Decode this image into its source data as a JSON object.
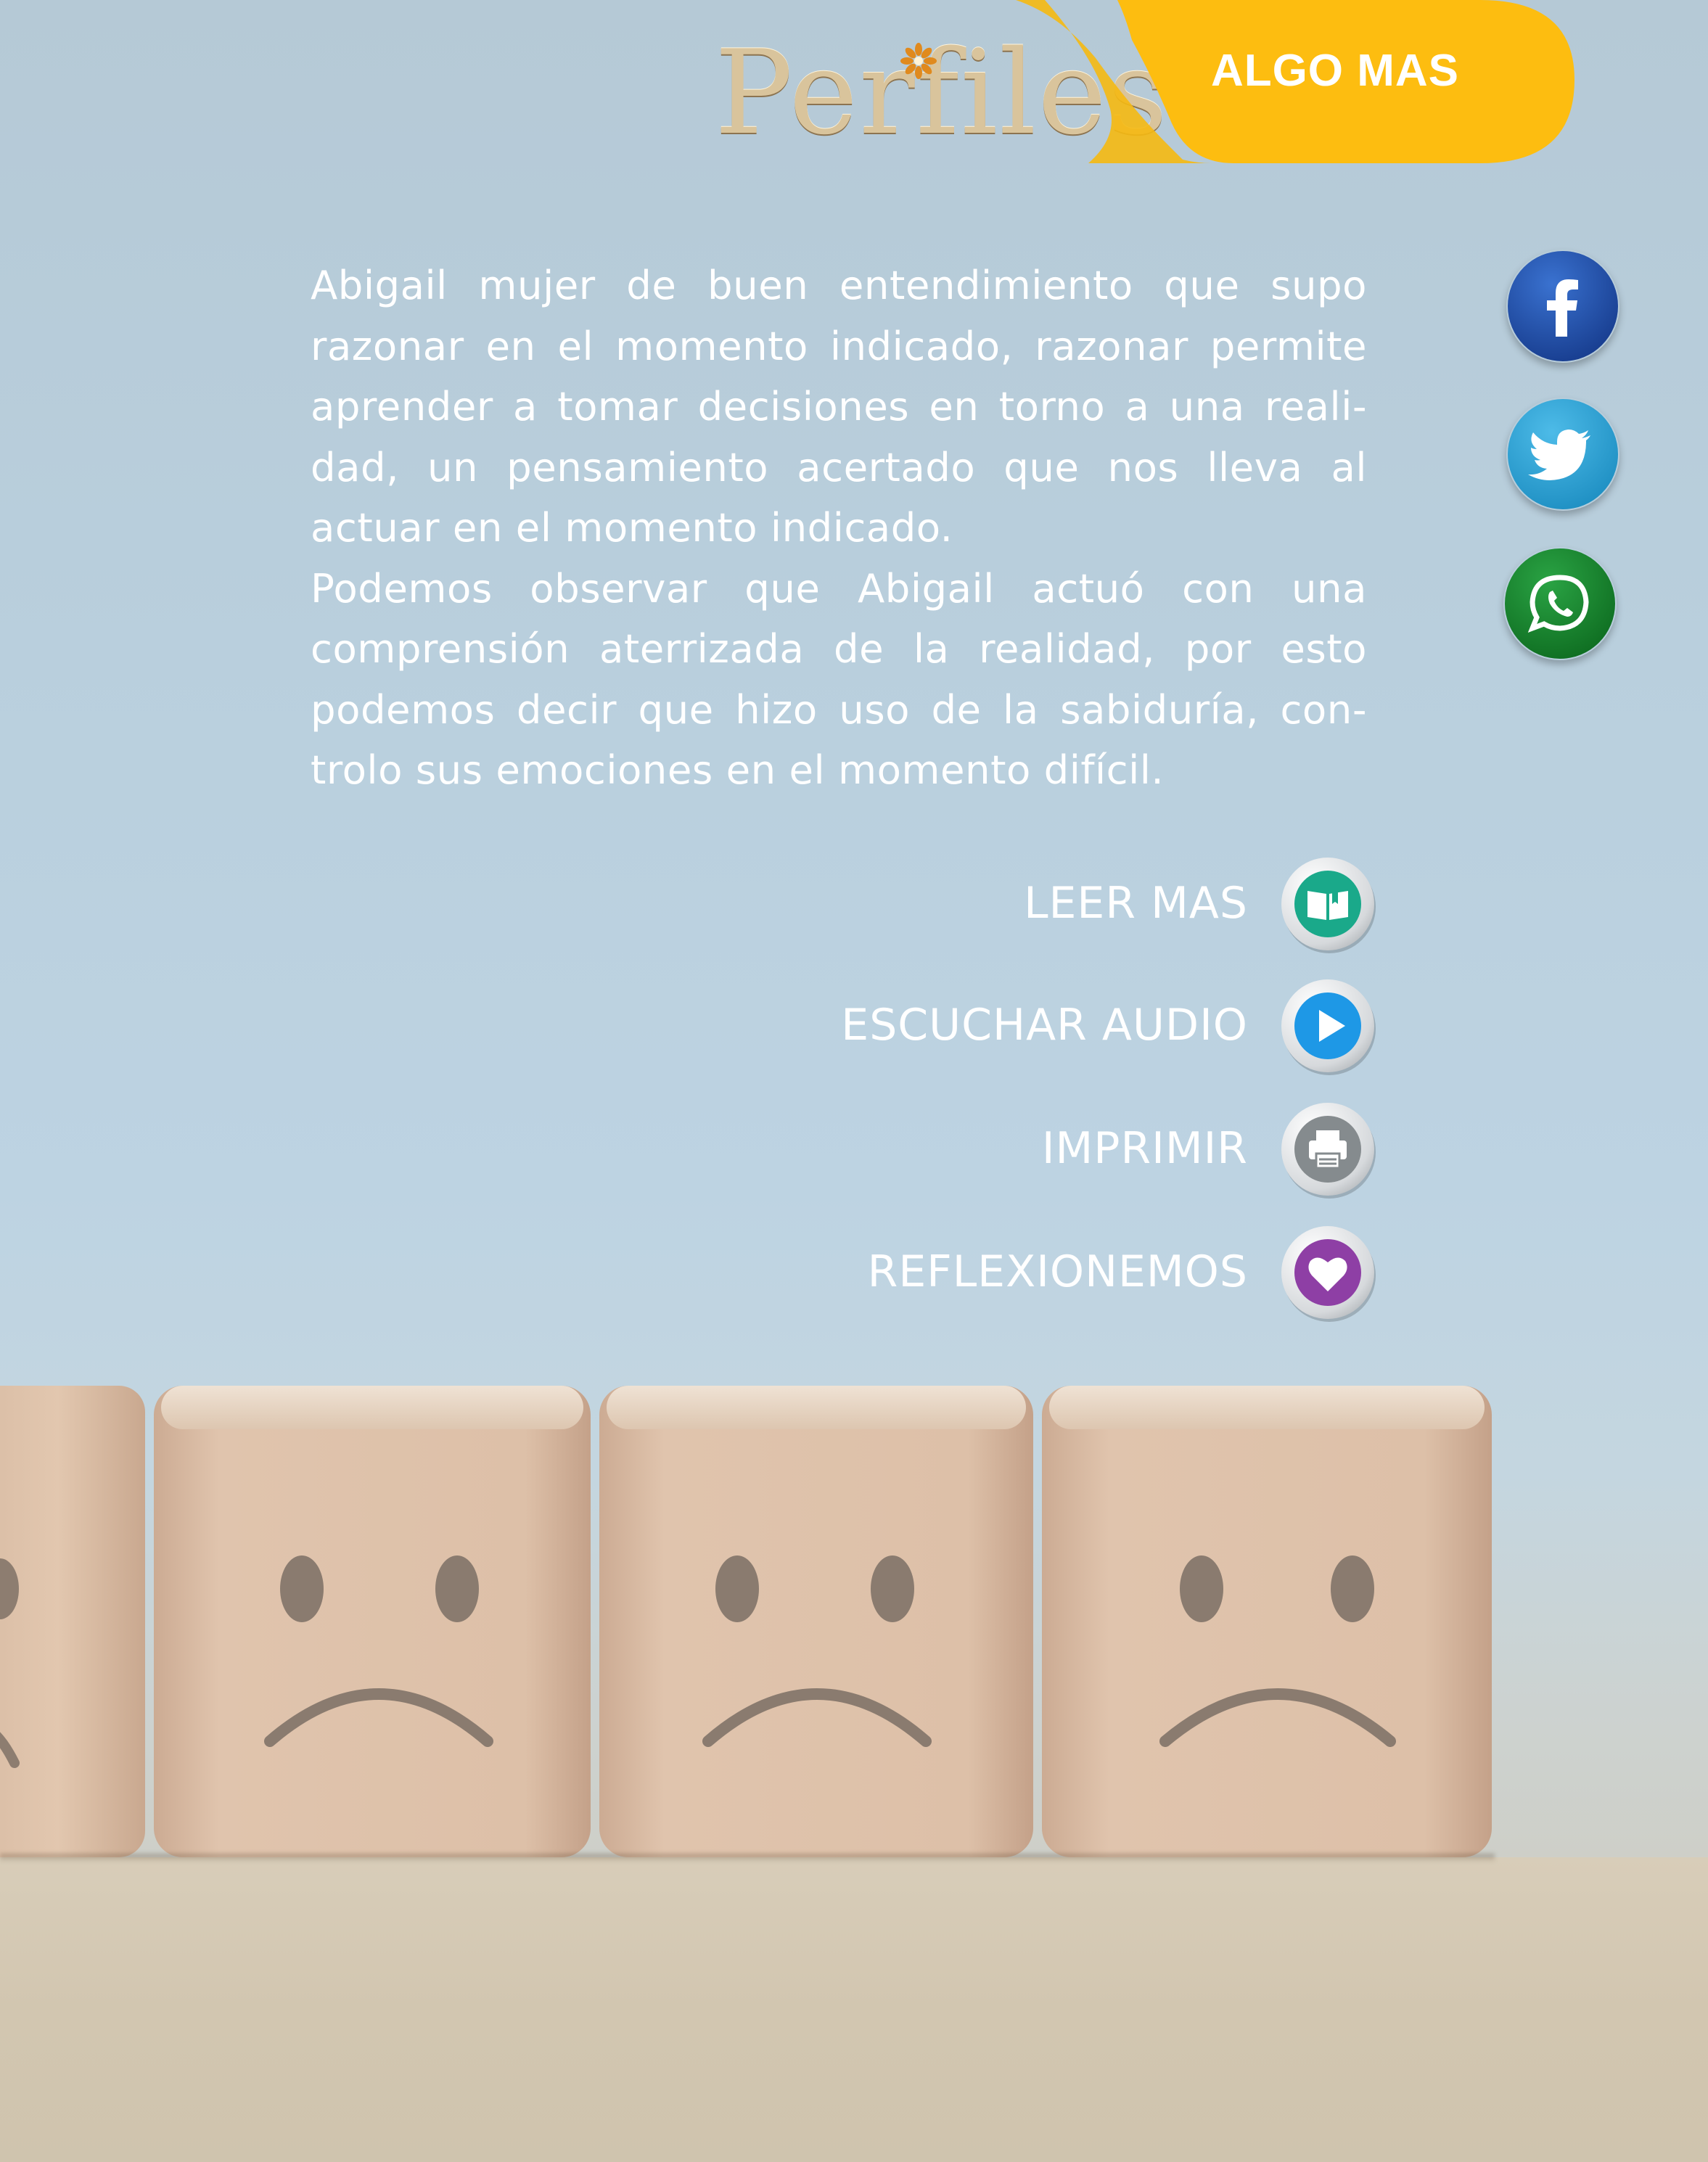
{
  "header": {
    "brand": "Perfiles",
    "tab_label": "ALGO MAS",
    "tab_color": "#fdbd10"
  },
  "social": [
    {
      "name": "facebook",
      "icon": "facebook-icon",
      "color": "#1e4fa3"
    },
    {
      "name": "twitter",
      "icon": "twitter-icon",
      "color": "#2aa3d6"
    },
    {
      "name": "whatsapp",
      "icon": "whatsapp-icon",
      "color": "#13852a"
    }
  ],
  "article": {
    "paragraphs": [
      "Abigail mujer de buen entendimiento que supo razonar en el momento indicado, razonar permite aprender a tomar decisiones en torno a una reali-dad, un pensamiento acertado que nos lleva al actuar en el momento indicado.",
      "Podemos observar que Abigail actuó con una comprensión aterrizada de la realidad, por esto podemos decir que hizo uso de la sabiduría, con-trolo sus emociones en el momento difícil."
    ]
  },
  "actions": [
    {
      "label": "LEER MAS",
      "icon": "book-icon",
      "color": "#1aa98a"
    },
    {
      "label": "ESCUCHAR AUDIO",
      "icon": "play-icon",
      "color": "#1e98e6"
    },
    {
      "label": "IMPRIMIR",
      "icon": "printer-icon",
      "color": "#858b8e"
    },
    {
      "label": "REFLEXIONEMOS",
      "icon": "heart-icon",
      "color": "#8e3fa5"
    }
  ],
  "image": {
    "subject": "sad-face-wooden-blocks"
  }
}
